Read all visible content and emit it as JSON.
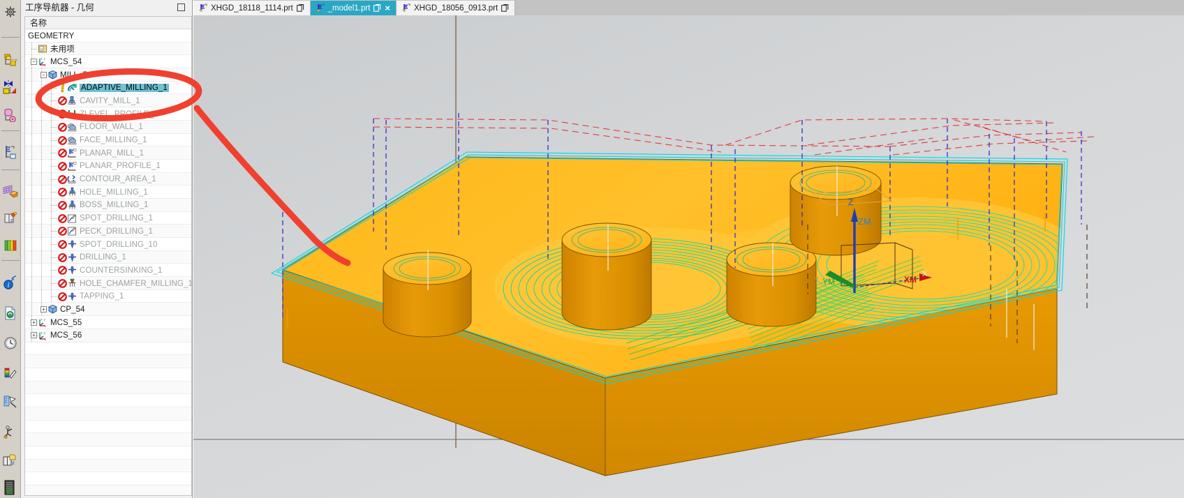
{
  "window": {
    "navigator_title": "工序导航器 - 几何",
    "restore_icon": "restore-window-icon"
  },
  "tabs": [
    {
      "label": "XHGD_18118_1114.prt",
      "active": false,
      "icon": "part-file-icon",
      "badge": "copy-icon",
      "closable": false
    },
    {
      "label": "_model1.prt",
      "active": true,
      "icon": "part-file-icon",
      "badge": "copy-icon",
      "closable": true,
      "close_label": "×"
    },
    {
      "label": "XHGD_18056_0913.prt",
      "active": false,
      "icon": "part-file-icon",
      "badge": "copy-icon",
      "closable": false
    }
  ],
  "tree": {
    "column_header": "名称",
    "items": [
      {
        "label": "GEOMETRY",
        "depth": 0,
        "icon": "none",
        "state": "root",
        "expander": "none"
      },
      {
        "label": "未用项",
        "depth": 1,
        "icon": "unused-icon",
        "state": "normal",
        "expander": "none"
      },
      {
        "label": "MCS_54",
        "depth": 1,
        "icon": "mcs-icon",
        "state": "normal",
        "expander": "minus"
      },
      {
        "label": "MILL_54",
        "depth": 2,
        "icon": "workpiece-icon",
        "state": "normal",
        "expander": "minus"
      },
      {
        "label": "ADAPTIVE_MILLING_1",
        "depth": 3,
        "icon": "adaptive-milling-icon",
        "state": "selected",
        "marker": "warning-icon",
        "expander": "none"
      },
      {
        "label": "CAVITY_MILL_1",
        "depth": 3,
        "icon": "cavity-mill-icon",
        "state": "disabled",
        "marker": "no-entry-icon",
        "expander": "none"
      },
      {
        "label": "ZLEVEL_PROFILE_1",
        "depth": 3,
        "icon": "zlevel-icon",
        "state": "disabled",
        "marker": "no-entry-icon",
        "expander": "none"
      },
      {
        "label": "FLOOR_WALL_1",
        "depth": 3,
        "icon": "floor-wall-icon",
        "state": "disabled",
        "marker": "no-entry-icon",
        "expander": "none"
      },
      {
        "label": "FACE_MILLING_1",
        "depth": 3,
        "icon": "floor-wall-icon",
        "state": "disabled",
        "marker": "no-entry-icon",
        "expander": "none"
      },
      {
        "label": "PLANAR_MILL_1",
        "depth": 3,
        "icon": "planar-mill-icon",
        "state": "disabled",
        "marker": "no-entry-icon",
        "expander": "none"
      },
      {
        "label": "PLANAR_PROFILE_1",
        "depth": 3,
        "icon": "planar-mill-icon",
        "state": "disabled",
        "marker": "no-entry-icon",
        "expander": "none"
      },
      {
        "label": "CONTOUR_AREA_1",
        "depth": 3,
        "icon": "contour-area-icon",
        "state": "disabled",
        "marker": "no-entry-icon",
        "expander": "none"
      },
      {
        "label": "HOLE_MILLING_1",
        "depth": 3,
        "icon": "hole-milling-icon",
        "state": "disabled",
        "marker": "no-entry-icon",
        "expander": "none"
      },
      {
        "label": "BOSS_MILLING_1",
        "depth": 3,
        "icon": "hole-milling-icon",
        "state": "disabled",
        "marker": "no-entry-icon",
        "expander": "none"
      },
      {
        "label": "SPOT_DRILLING_1",
        "depth": 3,
        "icon": "spot-drilling-icon",
        "state": "disabled",
        "marker": "no-entry-icon",
        "expander": "none"
      },
      {
        "label": "PECK_DRILLING_1",
        "depth": 3,
        "icon": "spot-drilling-icon",
        "state": "disabled",
        "marker": "no-entry-icon",
        "expander": "none"
      },
      {
        "label": "SPOT_DRILLING_10",
        "depth": 3,
        "icon": "drill-icon",
        "state": "disabled",
        "marker": "no-entry-icon",
        "expander": "none"
      },
      {
        "label": "DRILLING_1",
        "depth": 3,
        "icon": "drill-icon",
        "state": "disabled",
        "marker": "no-entry-icon",
        "expander": "none"
      },
      {
        "label": "COUNTERSINKING_1",
        "depth": 3,
        "icon": "drill-icon",
        "state": "disabled",
        "marker": "no-entry-icon",
        "expander": "none"
      },
      {
        "label": "HOLE_CHAMFER_MILLING_1",
        "depth": 3,
        "icon": "chamfer-mill-icon",
        "state": "disabled",
        "marker": "no-entry-icon",
        "expander": "none"
      },
      {
        "label": "TAPPING_1",
        "depth": 3,
        "icon": "drill-icon",
        "state": "disabled",
        "marker": "no-entry-icon",
        "expander": "none"
      },
      {
        "label": "CP_54",
        "depth": 2,
        "icon": "workpiece-icon",
        "state": "normal",
        "expander": "plus"
      },
      {
        "label": "MCS_55",
        "depth": 1,
        "icon": "mcs-icon",
        "state": "normal",
        "expander": "plus"
      },
      {
        "label": "MCS_56",
        "depth": 1,
        "icon": "mcs-icon",
        "state": "normal",
        "expander": "plus"
      }
    ]
  },
  "toolbar": {
    "items": [
      {
        "name": "settings-gear-icon"
      },
      {
        "name": "geometry-view-icon"
      },
      {
        "name": "machine-tool-view-icon"
      },
      {
        "name": "program-order-view-icon"
      },
      {
        "name": "machining-method-view-icon"
      },
      {
        "name": "workpiece-table-icon"
      },
      {
        "name": "edit-object-display-icon"
      },
      {
        "name": "layer-settings-icon"
      },
      {
        "name": "information-icon"
      },
      {
        "name": "refresh-document-icon"
      },
      {
        "name": "history-clock-icon"
      },
      {
        "name": "color-picker-icon"
      },
      {
        "name": "measure-icon"
      },
      {
        "name": "assembly-navigator-icon"
      },
      {
        "name": "reuse-library-icon"
      },
      {
        "name": "part-list-icon"
      }
    ]
  },
  "viewport": {
    "csys_labels": {
      "z": "Z",
      "zm": "ZM",
      "y": "Y",
      "ym": "YM",
      "x": "X",
      "xm": "XM"
    },
    "colors": {
      "part_top": "#FFB31A",
      "part_top_light": "#FFC233",
      "part_side": "#D68A00",
      "part_side_dark": "#C07C00",
      "toolpath_cut": "#00E0B0",
      "toolpath_engage": "#00E0E0",
      "rapid_move": "#E04040",
      "retract_move": "#2222C8",
      "csys_blue": "#1040C8",
      "csys_red": "#C81010",
      "annotation_red": "#F0402F",
      "background_top": "#c9ccce",
      "background_bottom": "#dcdee0"
    }
  },
  "annotation": {
    "shape": "red-ellipse-highlight",
    "arrow": "red-pointer-stroke",
    "target_label": "ADAPTIVE_MILLING_1"
  }
}
